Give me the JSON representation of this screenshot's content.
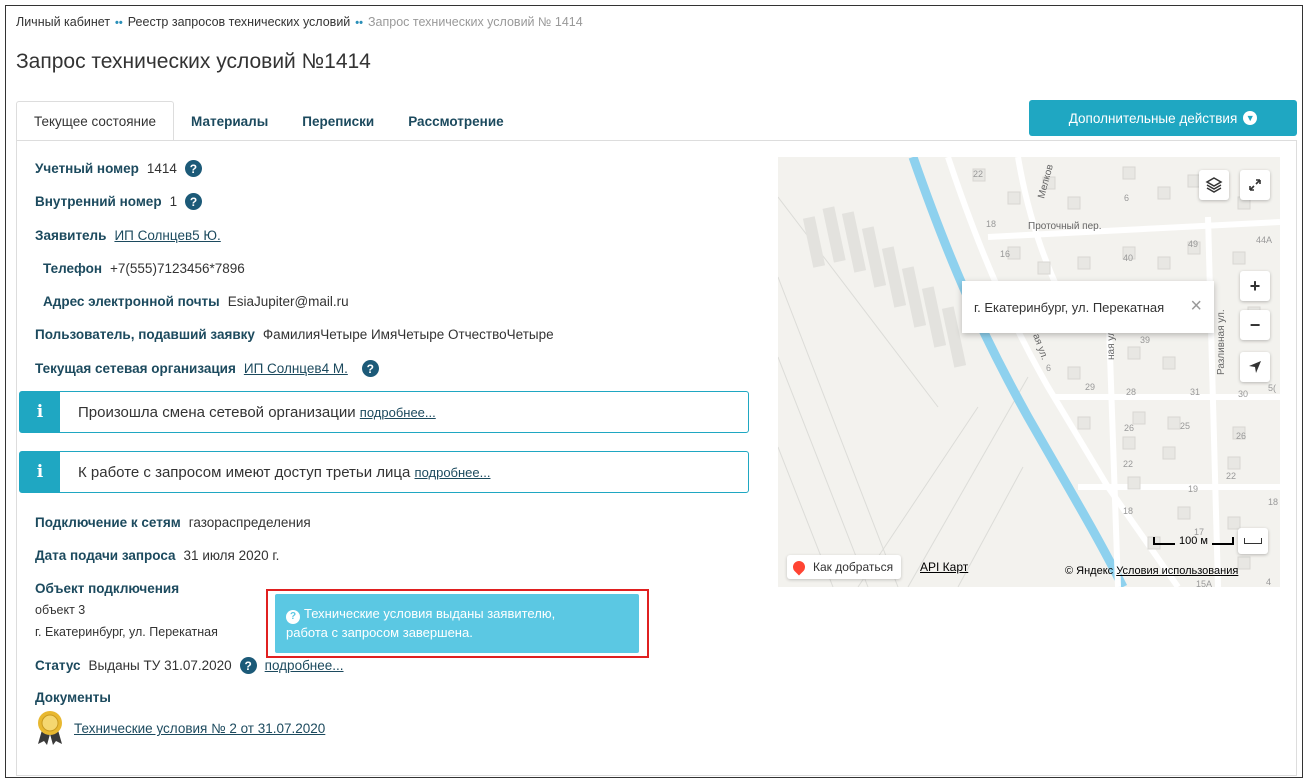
{
  "breadcrumbs": {
    "items": [
      "Личный кабинет",
      "Реестр запросов технических условий"
    ],
    "current": "Запрос технических условий № 1414",
    "separator": "••"
  },
  "page_title": "Запрос технических условий №1414",
  "tabs": [
    {
      "label": "Текущее состояние",
      "active": true
    },
    {
      "label": "Материалы",
      "active": false
    },
    {
      "label": "Переписки",
      "active": false
    },
    {
      "label": "Рассмотрение",
      "active": false
    }
  ],
  "actions_button": {
    "label": "Дополнительные действия",
    "color": "#1fa7c2"
  },
  "fields": {
    "account_number": {
      "label": "Учетный номер",
      "value": "1414"
    },
    "internal_number": {
      "label": "Внутренний номер",
      "value": "1"
    },
    "applicant": {
      "label": "Заявитель",
      "value": "ИП Солнцев5 Ю."
    },
    "phone": {
      "label": "Телефон",
      "value": "+7(555)7123456*7896"
    },
    "email": {
      "label": "Адрес электронной почты",
      "value": "EsiaJupiter@mail.ru"
    },
    "user": {
      "label": "Пользователь, подавший заявку",
      "value": "ФамилияЧетыре ИмяЧетыре ОтчествоЧетыре"
    },
    "network_org": {
      "label": "Текущая сетевая организация",
      "value": "ИП Солнцев4 М."
    },
    "connection": {
      "label": "Подключение к сетям",
      "value": "газораспределения"
    },
    "submit_date": {
      "label": "Дата подачи запроса",
      "value": "31 июля 2020 г."
    },
    "object": {
      "label": "Объект подключения",
      "name": "объект 3",
      "address": "г. Екатеринбург, ул. Перекатная"
    },
    "status": {
      "label": "Статус",
      "value": "Выданы ТУ 31.07.2020",
      "link": "подробнее..."
    },
    "documents": {
      "label": "Документы",
      "items": [
        "Технические условия № 2 от 31.07.2020"
      ]
    }
  },
  "alerts": [
    {
      "text": "Произошла смена сетевой организации",
      "link": "подробнее..."
    },
    {
      "text": "К работе с запросом имеют доступ третьи лица",
      "link": "подробнее..."
    }
  ],
  "tooltip": {
    "line1": "Технические условия выданы заявителю,",
    "line2": "работа с запросом завершена."
  },
  "map": {
    "balloon": "г. Екатеринбург, ул. Перекатная",
    "route_label": "Как добраться",
    "api_label": "API Карт",
    "copyright_prefix": "© Яндекс",
    "copyright_link": "Условия использования",
    "scale_label": "100 м",
    "street_labels": [
      "Проточный пер.",
      "Мелков",
      "Разливная ул.",
      "ая ул.",
      "ная ул."
    ],
    "house_numbers": [
      "22",
      "18",
      "16",
      "6",
      "40",
      "49",
      "44A",
      "42",
      "39",
      "29",
      "28",
      "31",
      "30",
      "26",
      "25",
      "26",
      "22",
      "22",
      "19",
      "18",
      "17",
      "18",
      "15A",
      "4",
      "6",
      "5("
    ]
  },
  "colors": {
    "accent": "#1fa7c2",
    "label": "#1c4a5e",
    "tooltip": "#5bc8e3",
    "highlight": "#e02020"
  }
}
